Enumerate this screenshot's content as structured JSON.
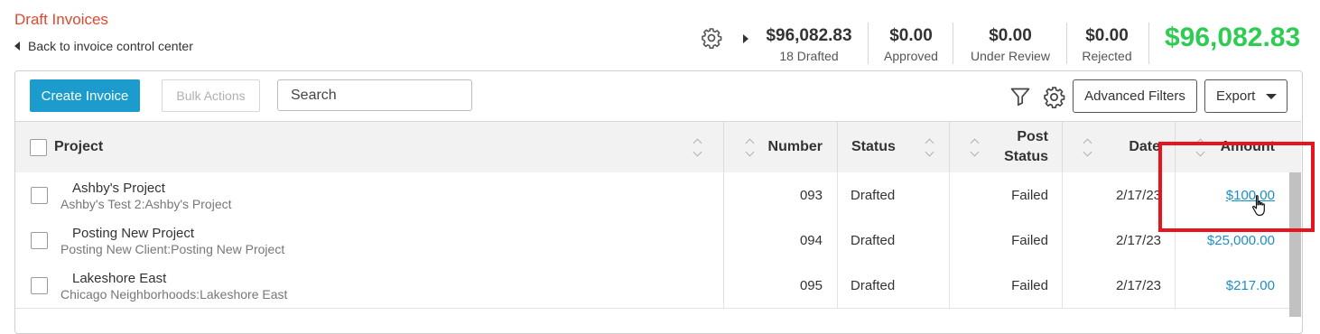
{
  "header": {
    "title": "Draft Invoices",
    "back_link": "Back to invoice control center"
  },
  "summary": {
    "drafted": {
      "value": "$96,082.83",
      "label": "18 Drafted"
    },
    "approved": {
      "value": "$0.00",
      "label": "Approved"
    },
    "under_review": {
      "value": "$0.00",
      "label": "Under Review"
    },
    "rejected": {
      "value": "$0.00",
      "label": "Rejected"
    },
    "grand_total": "$96,082.83"
  },
  "toolbar": {
    "create_label": "Create Invoice",
    "bulk_label": "Bulk Actions",
    "search_placeholder": "Search",
    "advanced_filters_label": "Advanced Filters",
    "export_label": "Export"
  },
  "columns": {
    "project": "Project",
    "number": "Number",
    "status": "Status",
    "post_status_line1": "Post",
    "post_status_line2": "Status",
    "date": "Date",
    "amount": "Amount"
  },
  "rows": [
    {
      "project": "Ashby's Project",
      "client": "Ashby's Test 2:Ashby's Project",
      "number": "093",
      "status": "Drafted",
      "post_status": "Failed",
      "date": "2/17/23",
      "amount": "$100.00"
    },
    {
      "project": "Posting New Project",
      "client": "Posting New Client:Posting New Project",
      "number": "094",
      "status": "Drafted",
      "post_status": "Failed",
      "date": "2/17/23",
      "amount": "$25,000.00"
    },
    {
      "project": "Lakeshore East",
      "client": "Chicago Neighborhoods:Lakeshore East",
      "number": "095",
      "status": "Drafted",
      "post_status": "Failed",
      "date": "2/17/23",
      "amount": "$217.00"
    }
  ],
  "colors": {
    "title": "#e0482e",
    "primary": "#1b9ccc",
    "grand_total": "#2ecc52",
    "link": "#1b8fc4",
    "highlight": "#e8141d"
  },
  "icons": [
    "gear-icon",
    "chevron-right-icon",
    "chevron-left-icon",
    "filter-icon",
    "caret-down-icon",
    "hand-cursor-icon"
  ]
}
